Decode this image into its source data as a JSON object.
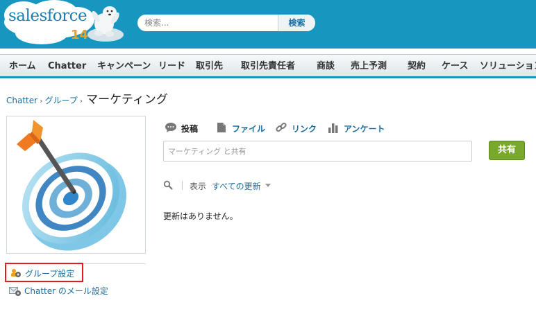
{
  "header": {
    "logo": {
      "brand": "salesforce",
      "version": "14"
    },
    "search": {
      "placeholder": "検索...",
      "value": "",
      "button_label": "検索"
    }
  },
  "tabs": [
    {
      "label": "ホーム"
    },
    {
      "label": "Chatter"
    },
    {
      "label": "キャンペーン"
    },
    {
      "label": "リード"
    },
    {
      "label": "取引先"
    },
    {
      "label": "取引先責任者"
    },
    {
      "label": "商談"
    },
    {
      "label": "売上予測"
    },
    {
      "label": "契約"
    },
    {
      "label": "ケース"
    },
    {
      "label": "ソリューション"
    }
  ],
  "breadcrumb": {
    "items": [
      "Chatter",
      "グループ"
    ],
    "separator": "›",
    "current": "マーケティング"
  },
  "sidebar": {
    "group_settings_label": "グループ設定",
    "email_settings_label": "Chatter のメール設定"
  },
  "publisher": {
    "actions": [
      {
        "label": "投稿",
        "icon": "speech-bubble-icon"
      },
      {
        "label": "ファイル",
        "icon": "file-icon"
      },
      {
        "label": "リンク",
        "icon": "link-icon"
      },
      {
        "label": "アンケート",
        "icon": "bar-chart-icon"
      }
    ],
    "share_placeholder": "マーケティング と共有",
    "share_button_label": "共有"
  },
  "feed": {
    "filter_label": "表示",
    "filter_value": "すべての更新",
    "empty_message": "更新はありません。"
  },
  "colors": {
    "header_bg": "#1797c0",
    "link": "#1b6da0",
    "share_button": "#78a82c",
    "highlight_box": "#e8191b"
  }
}
